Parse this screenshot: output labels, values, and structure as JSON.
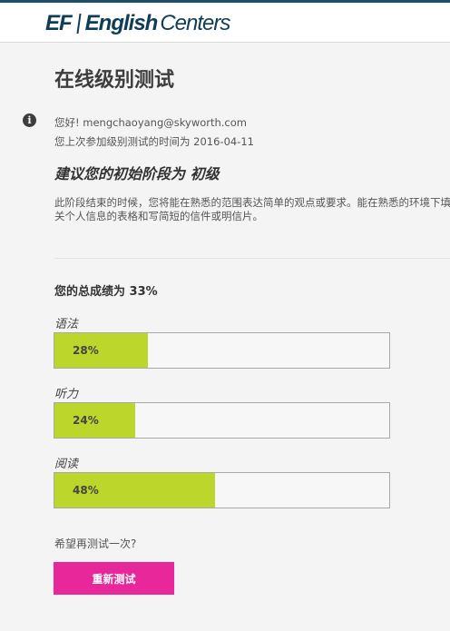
{
  "header": {
    "logo_ef": "EF",
    "logo_english": "English",
    "logo_centers": "Centers"
  },
  "page_title": "在线级别测试",
  "info": {
    "icon": "info-icon",
    "greeting": "您好! mengchaoyang@skyworth.com",
    "last_test": "您上次参加级别测试的时间为 2016-04-11"
  },
  "recommendation": "建议您的初始阶段为 初级",
  "description": "此阶段结束的时候，您将能在熟悉的范围表达简单的观点或要求。能在熟悉的环境下填写有关个人信息的表格和写简短的信件或明信片。",
  "results": {
    "total": "您的总成绩为 33%",
    "sections": [
      {
        "label": "语法",
        "score_text": "28%",
        "score": 28
      },
      {
        "label": "听力",
        "score_text": "24%",
        "score": 24
      },
      {
        "label": "阅读",
        "score_text": "48%",
        "score": 48
      }
    ]
  },
  "retry": {
    "prompt": "希望再测试一次?",
    "button_label": "重新测试"
  },
  "colors": {
    "brand": "#0f3d57",
    "bar_fill": "#bcd62b",
    "button": "#e8279a"
  }
}
